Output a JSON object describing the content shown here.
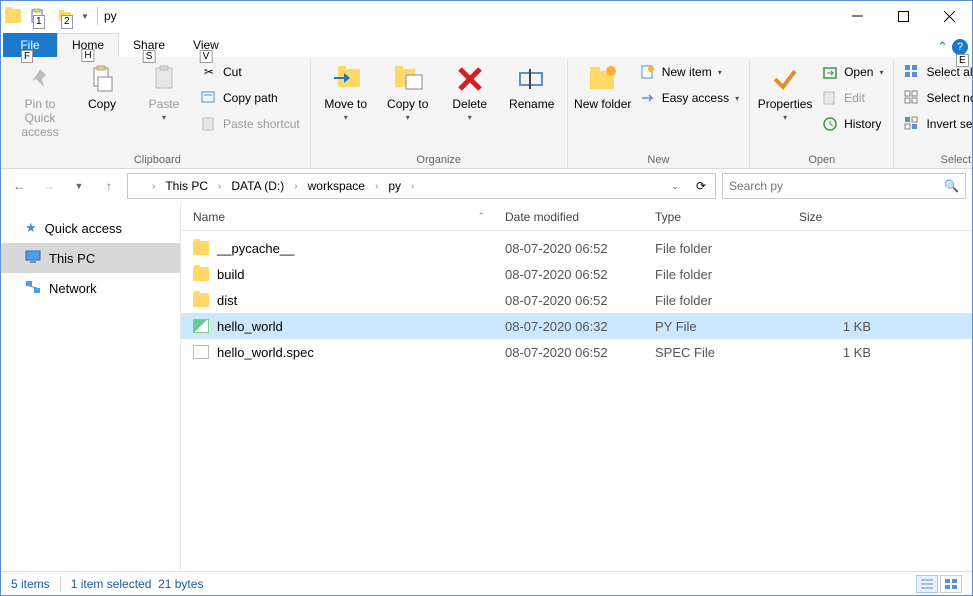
{
  "window": {
    "title": "py"
  },
  "qat_hints": {
    "one": "1",
    "two": "2"
  },
  "tabs": {
    "file": "File",
    "file_hint": "F",
    "home": "Home",
    "home_hint": "H",
    "share": "Share",
    "share_hint": "S",
    "view": "View",
    "view_hint": "V",
    "help_hint": "E"
  },
  "ribbon": {
    "clipboard": {
      "label": "Clipboard",
      "pin": "Pin to Quick access",
      "copy": "Copy",
      "paste": "Paste",
      "cut": "Cut",
      "copy_path": "Copy path",
      "paste_shortcut": "Paste shortcut"
    },
    "organize": {
      "label": "Organize",
      "move_to": "Move to",
      "copy_to": "Copy to",
      "delete": "Delete",
      "rename": "Rename"
    },
    "new": {
      "label": "New",
      "new_folder": "New folder",
      "new_item": "New item",
      "easy_access": "Easy access"
    },
    "open": {
      "label": "Open",
      "properties": "Properties",
      "open": "Open",
      "edit": "Edit",
      "history": "History"
    },
    "select_group": {
      "label": "Select",
      "select_all": "Select all",
      "select_none": "Select none",
      "invert": "Invert selection"
    }
  },
  "breadcrumbs": [
    "This PC",
    "DATA (D:)",
    "workspace",
    "py"
  ],
  "search": {
    "placeholder": "Search py"
  },
  "nav_pane": {
    "quick_access": "Quick access",
    "this_pc": "This PC",
    "network": "Network"
  },
  "columns": {
    "name": "Name",
    "date": "Date modified",
    "type": "Type",
    "size": "Size"
  },
  "files": [
    {
      "name": "__pycache__",
      "date": "08-07-2020 06:52",
      "type": "File folder",
      "size": "",
      "icon": "folder",
      "selected": false
    },
    {
      "name": "build",
      "date": "08-07-2020 06:52",
      "type": "File folder",
      "size": "",
      "icon": "folder",
      "selected": false
    },
    {
      "name": "dist",
      "date": "08-07-2020 06:52",
      "type": "File folder",
      "size": "",
      "icon": "folder",
      "selected": false
    },
    {
      "name": "hello_world",
      "date": "08-07-2020 06:32",
      "type": "PY File",
      "size": "1 KB",
      "icon": "py",
      "selected": true
    },
    {
      "name": "hello_world.spec",
      "date": "08-07-2020 06:52",
      "type": "SPEC File",
      "size": "1 KB",
      "icon": "file",
      "selected": false
    }
  ],
  "status": {
    "items": "5 items",
    "selected": "1 item selected",
    "size": "21 bytes"
  }
}
